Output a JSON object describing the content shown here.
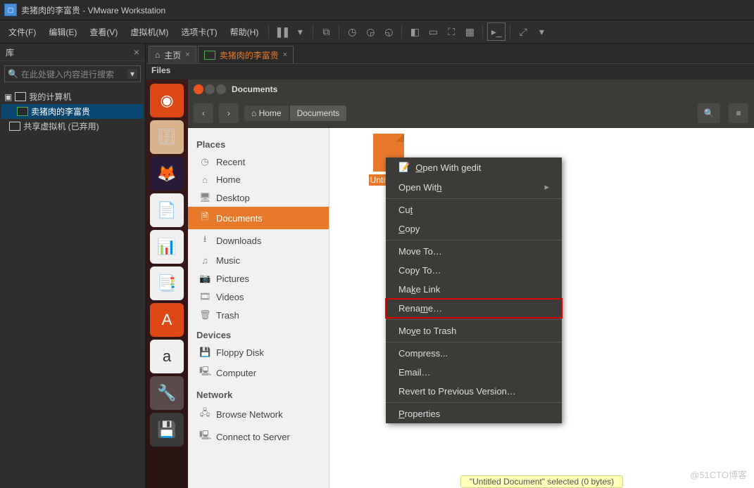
{
  "title": "卖猪肉的李富贵 - VMware Workstation",
  "menu": [
    "文件(F)",
    "编辑(E)",
    "查看(V)",
    "虚拟机(M)",
    "选项卡(T)",
    "帮助(H)"
  ],
  "lib": {
    "title": "库",
    "placeholder": "在此处键入内容进行搜索"
  },
  "tree": {
    "root": "我的计算机",
    "vm": "卖猪肉的李富贵",
    "shared": "共享虚拟机 (已弃用)"
  },
  "tabs": {
    "home": "主页",
    "vm": "卖猪肉的李富贵"
  },
  "files_app": "Files",
  "naut": {
    "title": "Documents",
    "home": "Home",
    "crumb": "Documents"
  },
  "places_h": {
    "p": "Places",
    "d": "Devices",
    "n": "Network"
  },
  "places": {
    "recent": "Recent",
    "home": "Home",
    "desktop": "Desktop",
    "documents": "Documents",
    "downloads": "Downloads",
    "music": "Music",
    "pictures": "Pictures",
    "videos": "Videos",
    "trash": "Trash",
    "floppy": "Floppy Disk",
    "computer": "Computer",
    "browse": "Browse Network",
    "connect": "Connect to Server"
  },
  "file_name": "Untitled D",
  "ctx": {
    "open_gedit": "Open With gedit",
    "open_with": "Open With",
    "cut": "Cut",
    "copy": "Copy",
    "move_to": "Move To…",
    "copy_to": "Copy To…",
    "make_link": "Make Link",
    "rename": "Rename…",
    "trash": "Move to Trash",
    "compress": "Compress...",
    "email": "Email…",
    "revert": "Revert to Previous Version…",
    "props": "Properties"
  },
  "status": "\"Untitled Document\" selected  (0 bytes)",
  "watermark": "@51CTO博客"
}
